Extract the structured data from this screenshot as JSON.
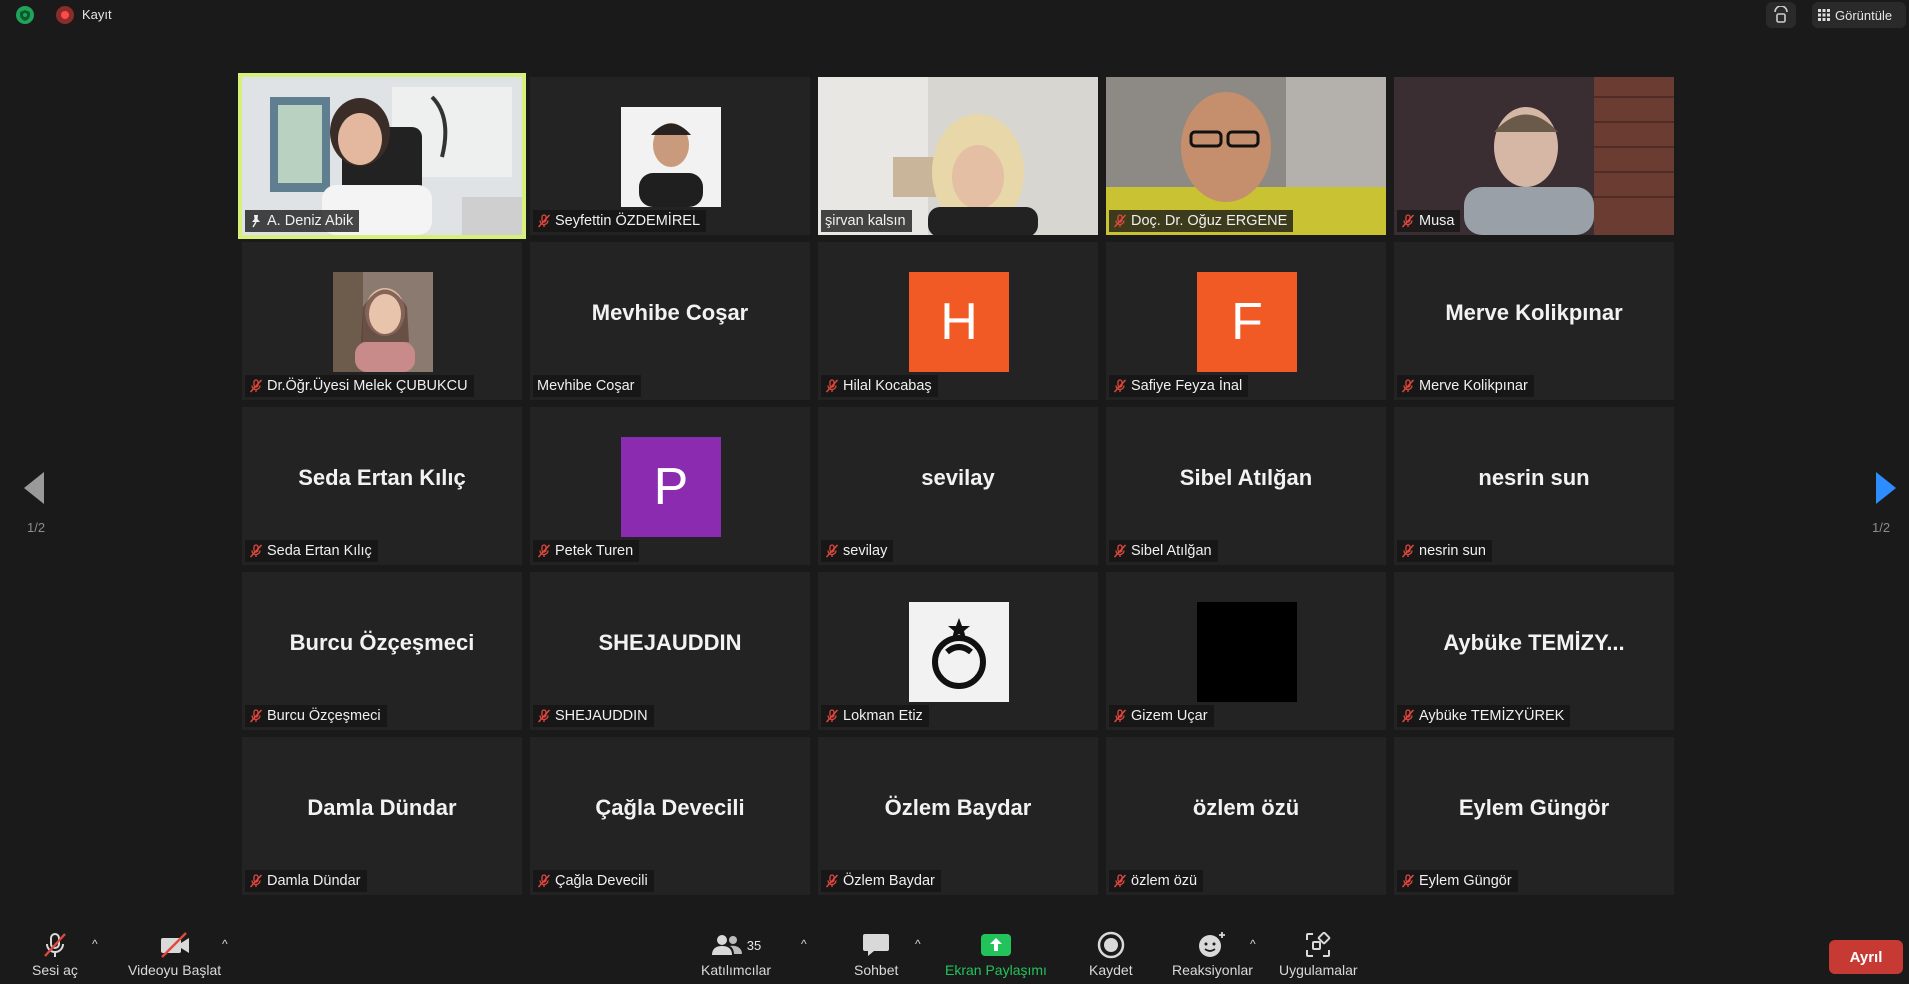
{
  "top": {
    "record_label": "Kayıt",
    "view_label": "Görüntüle"
  },
  "nav": {
    "page_left": "1/2",
    "page_right": "1/2"
  },
  "participants": [
    {
      "name": "A. Deniz Abik",
      "type": "video",
      "active": true,
      "pinned": true
    },
    {
      "name": "Seyfettin ÖZDEMİREL",
      "type": "photo",
      "muted": true
    },
    {
      "name": "şirvan kalsın",
      "type": "video",
      "muted": false
    },
    {
      "name": "Doç. Dr. Oğuz ERGENE",
      "type": "video",
      "muted": true
    },
    {
      "name": "Musa",
      "type": "video",
      "muted": true
    },
    {
      "name": "Dr.Öğr.Üyesi Melek ÇUBUKCU",
      "type": "photo",
      "muted": true
    },
    {
      "name": "Mevhibe Coşar",
      "display": "Mevhibe Coşar",
      "type": "name",
      "muted": false
    },
    {
      "name": "Hilal Kocabaş",
      "type": "letter",
      "letter": "H",
      "color": "#f15a24",
      "muted": true
    },
    {
      "name": "Safiye Feyza İnal",
      "type": "letter",
      "letter": "F",
      "color": "#f15a24",
      "muted": true
    },
    {
      "name": "Merve Kolikpınar",
      "display": "Merve Kolikpınar",
      "type": "name",
      "muted": true
    },
    {
      "name": "Seda Ertan Kılıç",
      "display": "Seda Ertan Kılıç",
      "type": "name",
      "muted": true
    },
    {
      "name": "Petek Turen",
      "type": "letter",
      "letter": "P",
      "color": "#8a2bb0",
      "muted": true
    },
    {
      "name": "sevilay",
      "display": "sevilay",
      "type": "name",
      "muted": true
    },
    {
      "name": "Sibel Atılğan",
      "display": "Sibel Atılğan",
      "type": "name",
      "muted": true
    },
    {
      "name": "nesrin sun",
      "display": "nesrin sun",
      "type": "name",
      "muted": true
    },
    {
      "name": "Burcu Özçeşmeci",
      "display": "Burcu Özçeşmeci",
      "type": "name",
      "muted": true
    },
    {
      "name": "SHEJAUDDIN",
      "display": "SHEJAUDDIN",
      "type": "name",
      "muted": true
    },
    {
      "name": "Lokman Etiz",
      "type": "logo",
      "muted": true
    },
    {
      "name": "Gizem Uçar",
      "type": "black",
      "muted": true
    },
    {
      "name": "Aybüke TEMİZYÜREK",
      "display": "Aybüke TEMİZY...",
      "type": "name",
      "muted": true
    },
    {
      "name": "Damla Dündar",
      "display": "Damla Dündar",
      "type": "name",
      "muted": true
    },
    {
      "name": "Çağla Devecili",
      "display": "Çağla Devecili",
      "type": "name",
      "muted": true
    },
    {
      "name": "Özlem Baydar",
      "display": "Özlem Baydar",
      "type": "name",
      "muted": true
    },
    {
      "name": "özlem özü",
      "display": "özlem özü",
      "type": "name",
      "muted": true
    },
    {
      "name": "Eylem Güngör",
      "display": "Eylem Güngör",
      "type": "name",
      "muted": true
    }
  ],
  "toolbar": {
    "unmute_label": "Sesi aç",
    "start_video_label": "Videoyu Başlat",
    "participants_label": "Katılımcılar",
    "participants_count": "35",
    "chat_label": "Sohbet",
    "share_label": "Ekran Paylaşımı",
    "record_label": "Kaydet",
    "reactions_label": "Reaksiyonlar",
    "apps_label": "Uygulamalar",
    "leave_label": "Ayrıl"
  },
  "colors": {
    "active_border": "#d6f07a",
    "share_green": "#23c35b",
    "leave_red": "#c73a34",
    "nav_right_blue": "#2d8cff"
  }
}
